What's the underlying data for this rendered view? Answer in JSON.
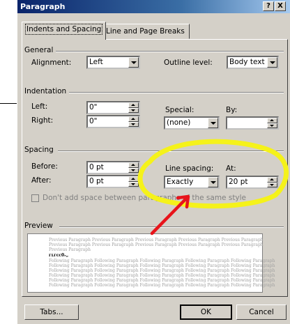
{
  "dialog": {
    "title": "Paragraph",
    "help_label": "?",
    "close_label": "X"
  },
  "tabs": [
    {
      "label": "Indents and Spacing",
      "active": true
    },
    {
      "label": "Line and Page Breaks",
      "active": false
    }
  ],
  "general": {
    "group_label": "General",
    "alignment_label": "Alignment:",
    "alignment_value": "Left",
    "outline_label": "Outline level:",
    "outline_value": "Body text"
  },
  "indentation": {
    "group_label": "Indentation",
    "left_label": "Left:",
    "left_value": "0\"",
    "right_label": "Right:",
    "right_value": "0\"",
    "special_label": "Special:",
    "special_value": "(none)",
    "by_label": "By:",
    "by_value": ""
  },
  "spacing": {
    "group_label": "Spacing",
    "before_label": "Before:",
    "before_value": "0 pt",
    "after_label": "After:",
    "after_value": "0 pt",
    "line_spacing_label": "Line spacing:",
    "line_spacing_value": "Exactly",
    "at_label": "At:",
    "at_value": "20 pt",
    "dont_add_label": "Don't add space between paragraphs of the same style"
  },
  "preview": {
    "group_label": "Preview",
    "lines": [
      "Previous Paragraph Previous Paragraph Previous Paragraph Previous Paragraph Previous Paragraph",
      "Previous Paragraph Previous Paragraph Previous Paragraph Previous Paragraph Previous Paragraph",
      "Previous Paragraph",
      "Following Paragraph Following Paragraph Following Paragraph Following Paragraph Following Paragraph",
      "Following Paragraph Following Paragraph Following Paragraph Following Paragraph Following Paragraph",
      "Following Paragraph Following Paragraph Following Paragraph Following Paragraph Following Paragraph",
      "Following Paragraph Following Paragraph Following Paragraph Following Paragraph Following Paragraph",
      "Following Paragraph Following Paragraph Following Paragraph Following Paragraph Following Paragraph",
      "Following Paragraph Following Paragraph Following Paragraph Following Paragraph Following Paragraph"
    ],
    "current_line": "ᴦʟᴦᴄᴄ0ᵣ„"
  },
  "buttons": {
    "tabs": "Tabs...",
    "ok": "OK",
    "cancel": "Cancel"
  },
  "colors": {
    "annotation": "#f5f21a",
    "arrow": "#e8141b",
    "titlebar": "#0a246a"
  }
}
